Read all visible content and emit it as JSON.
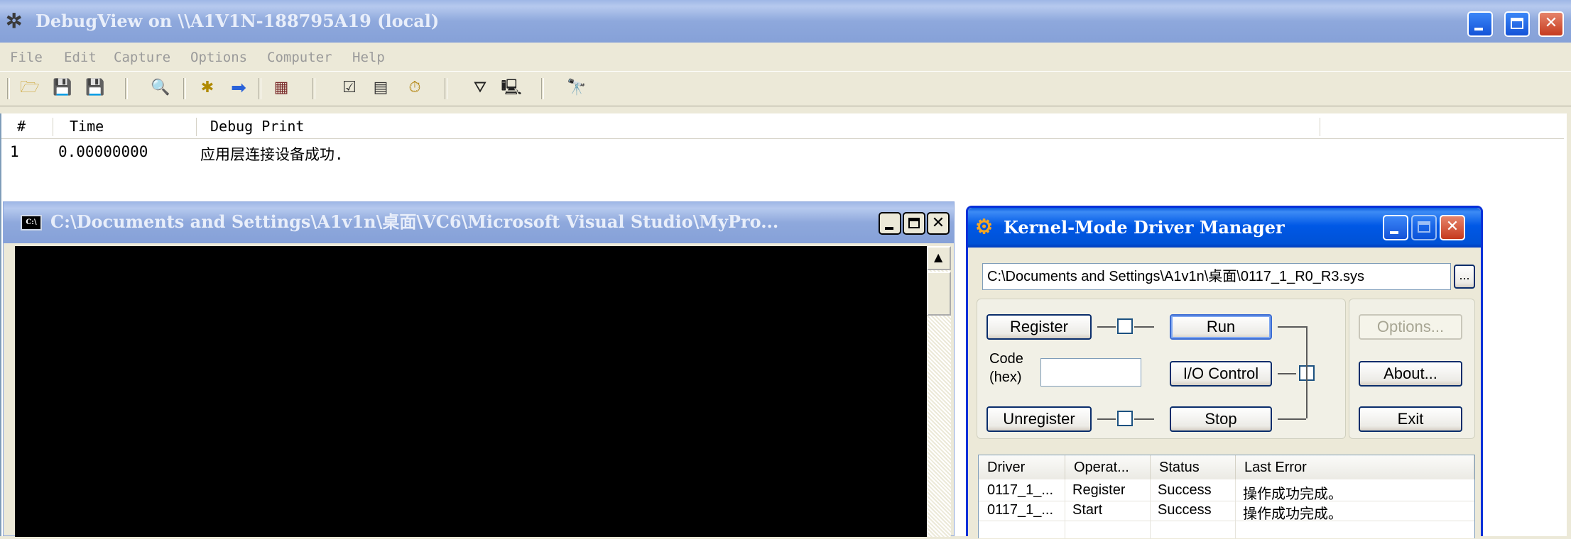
{
  "debugview": {
    "title": "DebugView on \\\\A1V1N-188795A19 (local)",
    "menu": [
      "File",
      "Edit",
      "Capture",
      "Options",
      "Computer",
      "Help"
    ],
    "columns": [
      "#",
      "Time",
      "Debug Print"
    ],
    "rows": [
      {
        "num": "1",
        "time": "0.00000000",
        "text": "应用层连接设备成功."
      }
    ]
  },
  "console": {
    "title": "C:\\Documents and Settings\\A1v1n\\桌面\\VC6\\Microsoft Visual Studio\\MyPro...",
    "icon_text": "C:\\"
  },
  "kmdm": {
    "title": "Kernel-Mode Driver Manager",
    "path_value": "C:\\Documents and Settings\\A1v1n\\桌面\\0117_1_R0_R3.sys",
    "browse_label": "...",
    "register_label": "Register",
    "run_label": "Run",
    "code_label_1": "Code",
    "code_label_2": "(hex)",
    "code_value": "",
    "io_label": "I/O Control",
    "unregister_label": "Unregister",
    "stop_label": "Stop",
    "options_label": "Options...",
    "about_label": "About...",
    "exit_label": "Exit",
    "columns": [
      "Driver",
      "Operat...",
      "Status",
      "Last Error"
    ],
    "rows": [
      {
        "driver": "0117_1_...",
        "op": "Register",
        "status": "Success",
        "error": "操作成功完成。"
      },
      {
        "driver": "0117_1_...",
        "op": "Start",
        "status": "Success",
        "error": "操作成功完成。"
      }
    ]
  },
  "colors": {
    "title_active": "#0058e6",
    "title_inactive": "#8ea8dc",
    "close_red": "#c63a1e",
    "xp_face": "#ece9d8"
  }
}
